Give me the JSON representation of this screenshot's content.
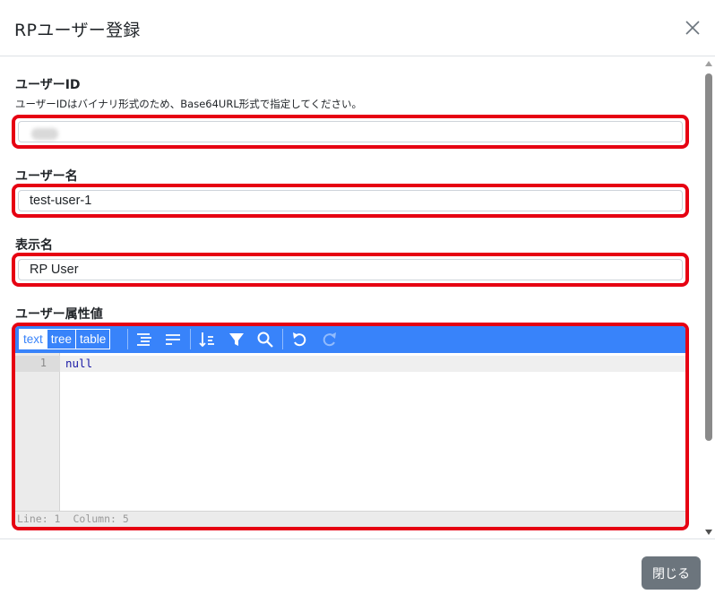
{
  "modal": {
    "title": "RPユーザー登録",
    "close_icon": "close-icon"
  },
  "form": {
    "user_id": {
      "label": "ユーザーID",
      "hint": "ユーザーIDはバイナリ形式のため、Base64URL形式で指定してください。",
      "value": ""
    },
    "user_name": {
      "label": "ユーザー名",
      "value": "test-user-1"
    },
    "display_name": {
      "label": "表示名",
      "value": "RP User"
    },
    "attributes": {
      "label": "ユーザー属性値"
    }
  },
  "json_editor": {
    "modes": [
      "text",
      "tree",
      "table"
    ],
    "active_mode": "text",
    "tools": [
      "format-icon",
      "compact-icon",
      "sort-icon",
      "filter-icon",
      "search-icon",
      "undo-icon",
      "redo-icon"
    ],
    "lines": [
      {
        "number": "1",
        "text": "null"
      }
    ],
    "status": {
      "line": "Line: 1",
      "column": "Column: 5"
    },
    "menu_color": "#3883fa"
  },
  "footer": {
    "close_label": "閉じる"
  },
  "colors": {
    "highlight": "#e60012",
    "button_secondary": "#6c757d"
  }
}
